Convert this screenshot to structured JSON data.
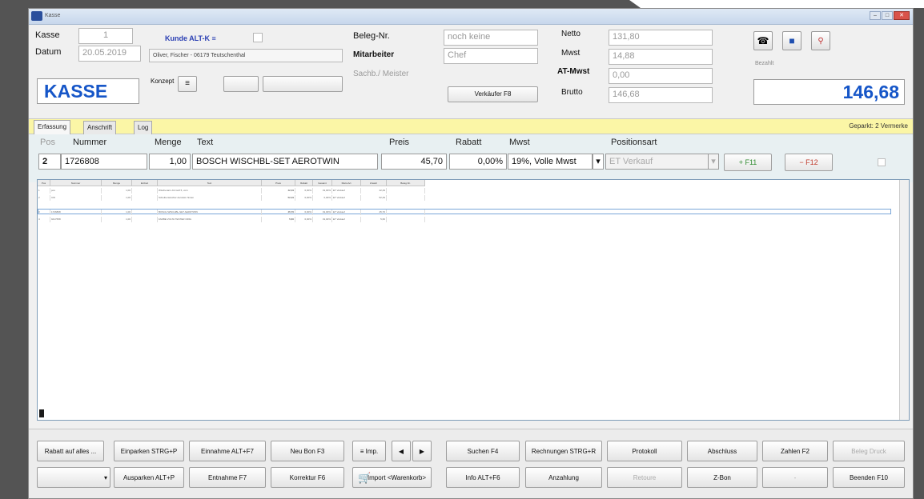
{
  "window": {
    "title": "Kasse"
  },
  "header": {
    "kasse_label": "Kasse",
    "kasse_value": "1",
    "datum_label": "Datum",
    "datum_value": "20.05.2019",
    "kunde_link": "Kunde ALT-K ≡",
    "kunde_value": "Oliver, Fischer - 06179 Teutschenthal",
    "konzept_label": "Konzept",
    "kasse_big": "KASSE",
    "beleg_label": "Beleg-Nr.",
    "beleg_value": "noch keine",
    "mitarbeiter_label": "Mitarbeiter",
    "mitarbeiter_value": "Chef",
    "sachb_label": "Sachb./ Meister",
    "verkaufer_button": "Verkäufer F8",
    "netto_label": "Netto",
    "netto_value": "131,80",
    "mwst_label": "Mwst",
    "mwst_value": "14,88",
    "at_mwst_label": "AT-Mwst",
    "at_mwst_value": "0,00",
    "brutto_label": "Brutto",
    "brutto_value": "146,68",
    "bezahlt_label": "Bezahlt",
    "total": "146,68"
  },
  "tabs": [
    "Erfassung",
    "Anschrift",
    "Log"
  ],
  "geparkt": "Geparkt: 2 Vermerke",
  "entry": {
    "pos_label": "Pos",
    "nummer_label": "Nummer",
    "menge_label": "Menge",
    "text_label": "Text",
    "preis_label": "Preis",
    "rabatt_label": "Rabatt",
    "mwst_label": "Mwst",
    "positionsart_label": "Positionsart",
    "pos": "2",
    "nummer": "1726808",
    "menge": "1,00",
    "text": "BOSCH WISCHBL-SET AEROTWIN",
    "preis": "45,70",
    "rabatt": "0,00%",
    "mwst": "19%, Volle Mwst",
    "positionsart": "ET Verkauf",
    "add_button": "+ F11",
    "remove_button": "− F12"
  },
  "grid": {
    "columns": [
      "Pos",
      "Nummer",
      "Menge",
      "Einheit",
      "Text",
      "Preis",
      "Rabatt",
      "Gesamt",
      "Mwst-Art",
      "Zusatz",
      "Beleg-Nr."
    ],
    "rows": [
      [
        "1",
        "pos",
        "1,00",
        "",
        "Wischerarm-Kit Golf 5, vorn",
        "42,49",
        "0,00%",
        "19,00%",
        "ET Verkauf",
        "42,49",
        ""
      ],
      [
        "2",
        "CW",
        "1,00",
        "",
        "Scheibenwischer Aerotwin hinten",
        "52,49",
        "0,00%",
        "0,00%",
        "ET Verkauf",
        "52,49",
        ""
      ],
      [
        "3",
        "1726808",
        "1,00",
        "",
        "BOSCH WISCHBL-SET AEROTWIN",
        "45,70",
        "0,00%",
        "19,00%",
        "ET Verkauf",
        "45,70",
        ""
      ],
      [
        "4",
        "9417658",
        "1,00",
        "",
        "FARBE VOLTA TESTER ORIG",
        "5,60",
        "0,00%",
        "19,00%",
        "ET Verkauf",
        "5,60",
        ""
      ]
    ]
  },
  "footer": {
    "row1": [
      "Rabatt auf alles ...",
      "Einparken STRG+P",
      "Einnahme ALT+F7",
      "Neu Bon F3",
      "≡ Imp.",
      "Suchen F4",
      "Rechnungen STRG+R",
      "Protokoll",
      "Abschluss",
      "Zahlen F2",
      "Beleg Druck"
    ],
    "row2": [
      "Ausparken ALT+P",
      "Entnahme F7",
      "Korrektur F6",
      "Import <Warenkorb>",
      "Info ALT+F6",
      "Anzahlung",
      "Retoure",
      "Z-Bon",
      "-",
      "Beenden F10"
    ]
  }
}
